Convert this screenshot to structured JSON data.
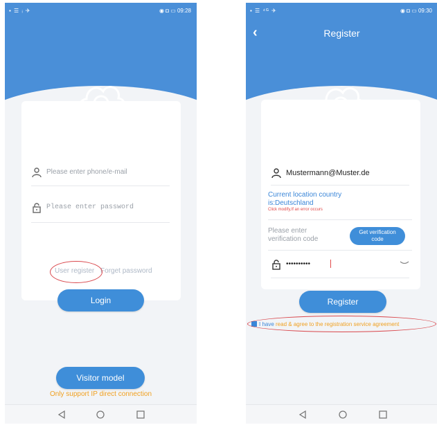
{
  "left": {
    "status": {
      "left": "▪ ☰ ᵢ ✈",
      "right": "◉ ◘ ▭ 09:28"
    },
    "phone_placeholder": "Please enter phone/e-mail",
    "password_placeholder": "Please enter password",
    "user_register": "User register",
    "forget_password": "Forget password",
    "login": "Login",
    "visitor_model": "Visitor model",
    "note": "Only support IP direct connection"
  },
  "right": {
    "status": {
      "left": "▪ ☰ ⁴ᴳ ✈",
      "right": "◉ ◘ ▭ 09:30"
    },
    "title": "Register",
    "email_value": "Mustermann@Muster.de",
    "location_line1": "Current location country",
    "location_line2": "is:Deutschland",
    "location_hint": "Click modify,If an error occurs",
    "code_placeholder_1": "Please enter",
    "code_placeholder_2": "verification code",
    "get_code_1": "Get verification",
    "get_code_2": "code",
    "password_masked": "••••••••••",
    "register_button": "Register",
    "agree_prefix": "I have",
    "agree_link": " read & agree to the registration service agreement"
  }
}
